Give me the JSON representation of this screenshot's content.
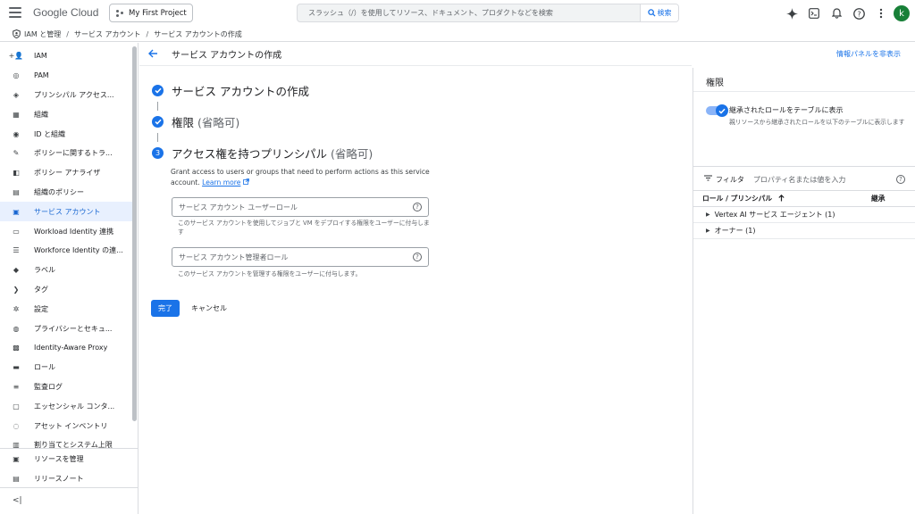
{
  "header": {
    "logo": "Google Cloud",
    "project": "My First Project",
    "search_placeholder": "スラッシュ（/）を使用してリソース、ドキュメント、プロダクトなどを検索",
    "search_button": "検索",
    "avatar_letter": "k"
  },
  "breadcrumb": [
    "IAM と管理",
    "サービス アカウント",
    "サービス アカウントの作成"
  ],
  "sidebar": {
    "items": [
      {
        "label": "IAM",
        "icon": "+👤"
      },
      {
        "label": "PAM",
        "icon": "◎"
      },
      {
        "label": "プリンシパル アクセス...",
        "icon": "◈"
      },
      {
        "label": "組織",
        "icon": "▦"
      },
      {
        "label": "ID と組織",
        "icon": "◉"
      },
      {
        "label": "ポリシーに関するトラ...",
        "icon": "✎"
      },
      {
        "label": "ポリシー アナライザ",
        "icon": "◧"
      },
      {
        "label": "組織のポリシー",
        "icon": "▤"
      },
      {
        "label": "サービス アカウント",
        "icon": "▣"
      },
      {
        "label": "Workload Identity 連携",
        "icon": "▭"
      },
      {
        "label": "Workforce Identity の連...",
        "icon": "☰"
      },
      {
        "label": "ラベル",
        "icon": "◆"
      },
      {
        "label": "タグ",
        "icon": "❯"
      },
      {
        "label": "設定",
        "icon": "✲"
      },
      {
        "label": "プライバシーとセキュ...",
        "icon": "◍"
      },
      {
        "label": "Identity-Aware Proxy",
        "icon": "▩"
      },
      {
        "label": "ロール",
        "icon": "▬"
      },
      {
        "label": "監査ログ",
        "icon": "≡"
      },
      {
        "label": "エッセンシャル コンタ...",
        "icon": "▢"
      },
      {
        "label": "アセット インベントリ",
        "icon": "◌"
      },
      {
        "label": "割り当てとシステム上限",
        "icon": "▥"
      }
    ],
    "active_index": 8,
    "bottom": [
      {
        "label": "リソースを管理",
        "icon": "▣"
      },
      {
        "label": "リリースノート",
        "icon": "▤"
      }
    ],
    "collapse_icon": "<|"
  },
  "main": {
    "title": "サービス アカウントの作成",
    "hide_panel": "情報パネルを非表示",
    "steps": [
      {
        "title": "サービス アカウントの作成",
        "optional": "",
        "state": "done"
      },
      {
        "title": "権限",
        "optional": "(省略可)",
        "state": "done"
      },
      {
        "title": "アクセス権を持つプリンシパル",
        "optional": "(省略可)",
        "state": "current",
        "number": "3"
      }
    ],
    "description": "Grant access to users or groups that need to perform actions as this service account.",
    "learn_more": "Learn more",
    "field1_placeholder": "サービス アカウント ユーザーロール",
    "field1_hint": "このサービス アカウントを使用してジョブと VM をデプロイする権限をユーザーに付与します",
    "field2_placeholder": "サービス アカウント管理者ロール",
    "field2_hint": "このサービス アカウントを管理する権限をユーザーに付与します。",
    "done_button": "完了",
    "cancel_button": "キャンセル"
  },
  "panel": {
    "title": "権限",
    "toggle_label": "継承されたロールをテーブルに表示",
    "toggle_desc": "親リソースから継承されたロールを以下のテーブルに表示します",
    "filter_label": "フィルタ",
    "filter_placeholder": "プロパティ名または値を入力",
    "col_role": "ロール / プリンシパル",
    "col_inherit": "継承",
    "rows": [
      "Vertex AI サービス エージェント (1)",
      "オーナー (1)"
    ]
  }
}
